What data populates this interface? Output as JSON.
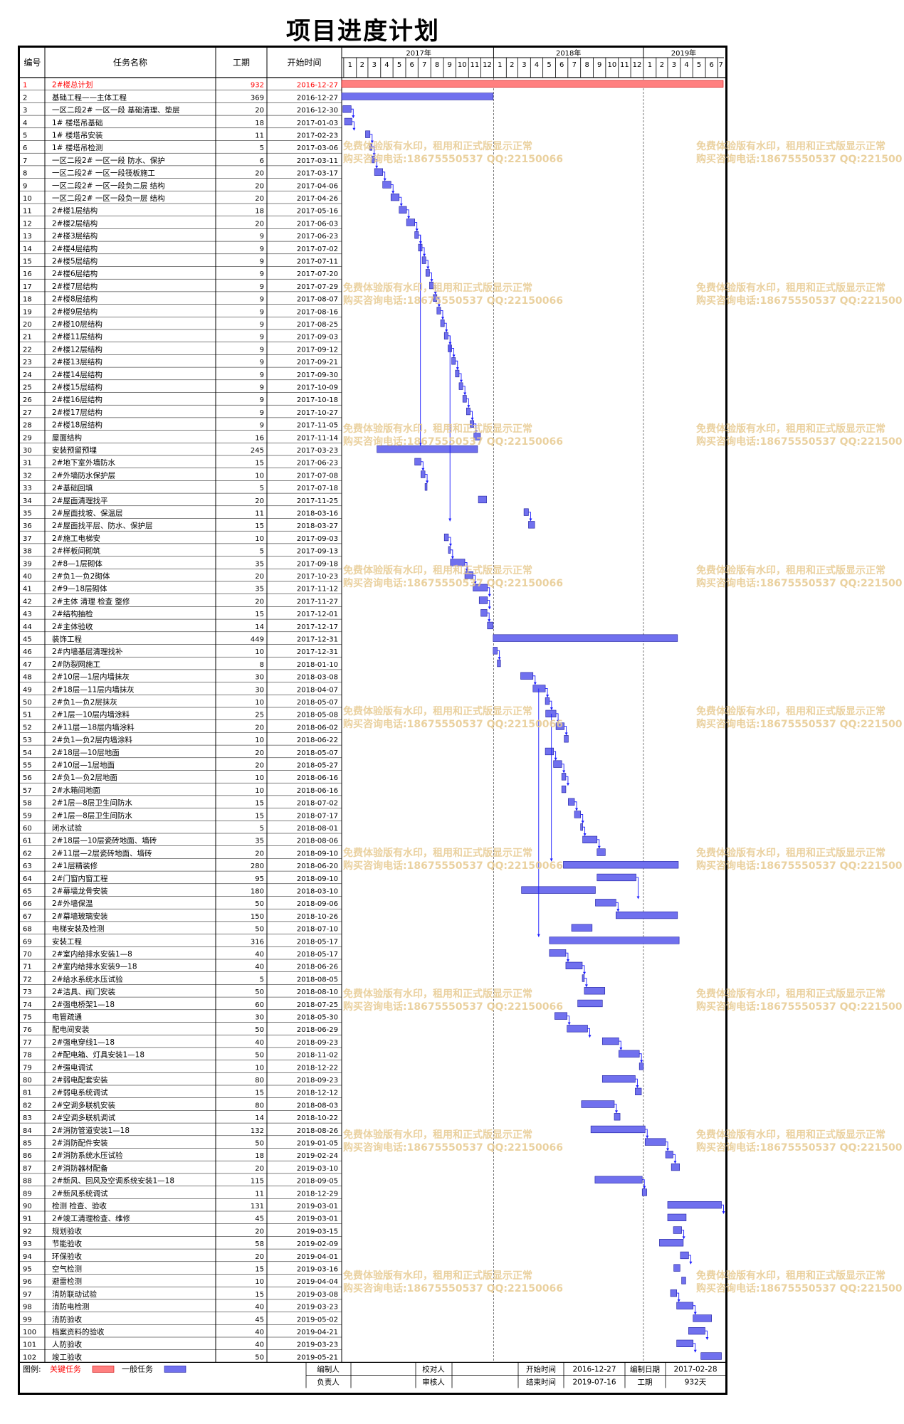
{
  "title": "项目进度计划",
  "columns": {
    "id": "编号",
    "name": "任务名称",
    "duration": "工期",
    "start": "开始时间"
  },
  "timeline": {
    "years": [
      {
        "label": "2017年",
        "months": [
          "1",
          "2",
          "3",
          "4",
          "5",
          "6",
          "7",
          "8",
          "9",
          "10",
          "11",
          "12"
        ]
      },
      {
        "label": "2018年",
        "months": [
          "1",
          "2",
          "3",
          "4",
          "5",
          "6",
          "7",
          "8",
          "9",
          "10",
          "11",
          "12"
        ]
      },
      {
        "label": "2019年",
        "months": [
          "1",
          "2",
          "3",
          "4",
          "5",
          "6",
          "7"
        ]
      }
    ]
  },
  "colors": {
    "critical": "#ff7f7f",
    "normal": "#7070ee",
    "critical_text": "#ff0000",
    "link": "#1c1cff"
  },
  "chart_data": {
    "type": "gantt",
    "timeline_start": "2016-12-27",
    "tasks": [
      {
        "id": "1",
        "name": "2#楼总计划",
        "duration": "932",
        "start": "2016-12-27",
        "critical": true
      },
      {
        "id": "2",
        "name": "基础工程——主体工程",
        "duration": "369",
        "start": "2016-12-27"
      },
      {
        "id": "3",
        "name": "一区二段2# 一区一段 基础清理、垫层",
        "duration": "20",
        "start": "2016-12-30"
      },
      {
        "id": "4",
        "name": "1# 楼塔吊基础",
        "duration": "18",
        "start": "2017-01-03"
      },
      {
        "id": "5",
        "name": "1# 楼塔吊安装",
        "duration": "11",
        "start": "2017-02-23"
      },
      {
        "id": "6",
        "name": "1# 楼塔吊检测",
        "duration": "5",
        "start": "2017-03-06"
      },
      {
        "id": "7",
        "name": "一区二段2# 一区一段 防水、保护",
        "duration": "6",
        "start": "2017-03-11"
      },
      {
        "id": "8",
        "name": "一区二段2# 一区一段筏板施工",
        "duration": "20",
        "start": "2017-03-17"
      },
      {
        "id": "9",
        "name": "一区二段2# 一区一段负二层 结构",
        "duration": "20",
        "start": "2017-04-06"
      },
      {
        "id": "10",
        "name": "一区二段2# 一区一段负一层 结构",
        "duration": "20",
        "start": "2017-04-26"
      },
      {
        "id": "11",
        "name": "2#楼1层结构",
        "duration": "18",
        "start": "2017-05-16"
      },
      {
        "id": "12",
        "name": "2#楼2层结构",
        "duration": "20",
        "start": "2017-06-03"
      },
      {
        "id": "13",
        "name": "2#楼3层结构",
        "duration": "9",
        "start": "2017-06-23"
      },
      {
        "id": "14",
        "name": "2#楼4层结构",
        "duration": "9",
        "start": "2017-07-02"
      },
      {
        "id": "15",
        "name": "2#楼5层结构",
        "duration": "9",
        "start": "2017-07-11"
      },
      {
        "id": "16",
        "name": "2#楼6层结构",
        "duration": "9",
        "start": "2017-07-20"
      },
      {
        "id": "17",
        "name": "2#楼7层结构",
        "duration": "9",
        "start": "2017-07-29"
      },
      {
        "id": "18",
        "name": "2#楼8层结构",
        "duration": "9",
        "start": "2017-08-07"
      },
      {
        "id": "19",
        "name": "2#楼9层结构",
        "duration": "9",
        "start": "2017-08-16"
      },
      {
        "id": "20",
        "name": "2#楼10层结构",
        "duration": "9",
        "start": "2017-08-25"
      },
      {
        "id": "21",
        "name": "2#楼11层结构",
        "duration": "9",
        "start": "2017-09-03"
      },
      {
        "id": "22",
        "name": "2#楼12层结构",
        "duration": "9",
        "start": "2017-09-12"
      },
      {
        "id": "23",
        "name": "2#楼13层结构",
        "duration": "9",
        "start": "2017-09-21"
      },
      {
        "id": "24",
        "name": "2#楼14层结构",
        "duration": "9",
        "start": "2017-09-30"
      },
      {
        "id": "25",
        "name": "2#楼15层结构",
        "duration": "9",
        "start": "2017-10-09"
      },
      {
        "id": "26",
        "name": "2#楼16层结构",
        "duration": "9",
        "start": "2017-10-18"
      },
      {
        "id": "27",
        "name": "2#楼17层结构",
        "duration": "9",
        "start": "2017-10-27"
      },
      {
        "id": "28",
        "name": "2#楼18层结构",
        "duration": "9",
        "start": "2017-11-05"
      },
      {
        "id": "29",
        "name": "屋面结构",
        "duration": "16",
        "start": "2017-11-14"
      },
      {
        "id": "30",
        "name": "安装预留预埋",
        "duration": "245",
        "start": "2017-03-23"
      },
      {
        "id": "31",
        "name": "2#地下室外墙防水",
        "duration": "15",
        "start": "2017-06-23"
      },
      {
        "id": "32",
        "name": "2#外墙防水保护层",
        "duration": "10",
        "start": "2017-07-08"
      },
      {
        "id": "33",
        "name": "2#基础回填",
        "duration": "5",
        "start": "2017-07-18"
      },
      {
        "id": "34",
        "name": "2#屋面清理找平",
        "duration": "20",
        "start": "2017-11-25"
      },
      {
        "id": "35",
        "name": "2#屋面找坡、保温层",
        "duration": "11",
        "start": "2018-03-16"
      },
      {
        "id": "36",
        "name": "2#屋面找平层、防水、保护层",
        "duration": "15",
        "start": "2018-03-27"
      },
      {
        "id": "37",
        "name": "2#施工电梯安",
        "duration": "10",
        "start": "2017-09-03"
      },
      {
        "id": "38",
        "name": "2#样板间砌筑",
        "duration": "5",
        "start": "2017-09-13"
      },
      {
        "id": "39",
        "name": "2#8—1层砌体",
        "duration": "35",
        "start": "2017-09-18"
      },
      {
        "id": "40",
        "name": "2#负1—负2砌体",
        "duration": "20",
        "start": "2017-10-23"
      },
      {
        "id": "41",
        "name": "2#9—18层砌体",
        "duration": "35",
        "start": "2017-11-12"
      },
      {
        "id": "42",
        "name": "2#主体 清理 检查 整修",
        "duration": "20",
        "start": "2017-11-27"
      },
      {
        "id": "43",
        "name": "2#结构抽检",
        "duration": "15",
        "start": "2017-12-01"
      },
      {
        "id": "44",
        "name": "2#主体验收",
        "duration": "14",
        "start": "2017-12-17"
      },
      {
        "id": "45",
        "name": "装饰工程",
        "duration": "449",
        "start": "2017-12-31"
      },
      {
        "id": "46",
        "name": "2#内墙基层清理找补",
        "duration": "10",
        "start": "2017-12-31"
      },
      {
        "id": "47",
        "name": "2#防裂网施工",
        "duration": "8",
        "start": "2018-01-10"
      },
      {
        "id": "48",
        "name": "2#10层—1层内墙抹灰",
        "duration": "30",
        "start": "2018-03-08"
      },
      {
        "id": "49",
        "name": "2#18层—11层内墙抹灰",
        "duration": "30",
        "start": "2018-04-07"
      },
      {
        "id": "50",
        "name": "2#负1—负2层抹灰",
        "duration": "10",
        "start": "2018-05-07"
      },
      {
        "id": "51",
        "name": "2#1层—10层内墙涂料",
        "duration": "25",
        "start": "2018-05-08"
      },
      {
        "id": "52",
        "name": "2#11层—18层内墙涂料",
        "duration": "20",
        "start": "2018-06-02"
      },
      {
        "id": "53",
        "name": "2#负1—负2层内墙涂料",
        "duration": "10",
        "start": "2018-06-22"
      },
      {
        "id": "54",
        "name": "2#18层—10层地面",
        "duration": "20",
        "start": "2018-05-07"
      },
      {
        "id": "55",
        "name": "2#10层—1层地面",
        "duration": "20",
        "start": "2018-05-27"
      },
      {
        "id": "56",
        "name": "2#负1—负2层地面",
        "duration": "10",
        "start": "2018-06-16"
      },
      {
        "id": "57",
        "name": "2#水箱间地面",
        "duration": "10",
        "start": "2018-06-16"
      },
      {
        "id": "58",
        "name": "2#1层—8层卫生间防水",
        "duration": "15",
        "start": "2018-07-02"
      },
      {
        "id": "59",
        "name": "2#1层—8层卫生间防水",
        "duration": "15",
        "start": "2018-07-17"
      },
      {
        "id": "60",
        "name": "闭水试验",
        "duration": "5",
        "start": "2018-08-01"
      },
      {
        "id": "61",
        "name": "2#18层—10层瓷砖地面、墙砖",
        "duration": "35",
        "start": "2018-08-06"
      },
      {
        "id": "62",
        "name": "2#11层—2层瓷砖地面、墙砖",
        "duration": "20",
        "start": "2018-09-10"
      },
      {
        "id": "63",
        "name": "2#1层精装修",
        "duration": "280",
        "start": "2018-06-20"
      },
      {
        "id": "64",
        "name": "2#门窗内窗工程",
        "duration": "95",
        "start": "2018-09-10"
      },
      {
        "id": "65",
        "name": "2#幕墙龙骨安装",
        "duration": "180",
        "start": "2018-03-10"
      },
      {
        "id": "66",
        "name": "2#外墙保温",
        "duration": "50",
        "start": "2018-09-06"
      },
      {
        "id": "67",
        "name": "2#幕墙玻璃安装",
        "duration": "150",
        "start": "2018-10-26"
      },
      {
        "id": "68",
        "name": "电梯安装及检测",
        "duration": "50",
        "start": "2018-07-10"
      },
      {
        "id": "69",
        "name": "安装工程",
        "duration": "316",
        "start": "2018-05-17"
      },
      {
        "id": "70",
        "name": "2#室内给排水安装1—8",
        "duration": "40",
        "start": "2018-05-17"
      },
      {
        "id": "71",
        "name": "2#室内给排水安装9—18",
        "duration": "40",
        "start": "2018-06-26"
      },
      {
        "id": "72",
        "name": "2#给水系统水压试验",
        "duration": "5",
        "start": "2018-08-05"
      },
      {
        "id": "73",
        "name": "2#洁具、阀门安装",
        "duration": "50",
        "start": "2018-08-10"
      },
      {
        "id": "74",
        "name": "2#强电桥架1—18",
        "duration": "60",
        "start": "2018-07-25"
      },
      {
        "id": "75",
        "name": "电管疏通",
        "duration": "30",
        "start": "2018-05-30"
      },
      {
        "id": "76",
        "name": "配电间安装",
        "duration": "50",
        "start": "2018-06-29"
      },
      {
        "id": "77",
        "name": "2#强电穿线1—18",
        "duration": "40",
        "start": "2018-09-23"
      },
      {
        "id": "78",
        "name": "2#配电箱、灯具安装1—18",
        "duration": "50",
        "start": "2018-11-02"
      },
      {
        "id": "79",
        "name": "2#强电调试",
        "duration": "10",
        "start": "2018-12-22"
      },
      {
        "id": "80",
        "name": "2#弱电配套安装",
        "duration": "80",
        "start": "2018-09-23"
      },
      {
        "id": "81",
        "name": "2#弱电系统调试",
        "duration": "15",
        "start": "2018-12-12"
      },
      {
        "id": "82",
        "name": "2#空调多联机安装",
        "duration": "80",
        "start": "2018-08-03"
      },
      {
        "id": "83",
        "name": "2#空调多联机调试",
        "duration": "14",
        "start": "2018-10-22"
      },
      {
        "id": "84",
        "name": "2#消防管道安装1—18",
        "duration": "132",
        "start": "2018-08-26"
      },
      {
        "id": "85",
        "name": "2#消防配件安装",
        "duration": "50",
        "start": "2019-01-05"
      },
      {
        "id": "86",
        "name": "2#消防系统水压试验",
        "duration": "18",
        "start": "2019-02-24"
      },
      {
        "id": "87",
        "name": "2#消防器材配备",
        "duration": "20",
        "start": "2019-03-10"
      },
      {
        "id": "88",
        "name": "2#新风、回风及空调系统安装1—18",
        "duration": "115",
        "start": "2018-09-05"
      },
      {
        "id": "89",
        "name": "2#新风系统调试",
        "duration": "11",
        "start": "2018-12-29"
      },
      {
        "id": "90",
        "name": "检测 检查、验收",
        "duration": "131",
        "start": "2019-03-01"
      },
      {
        "id": "91",
        "name": "2#竣工清理检查、维修",
        "duration": "45",
        "start": "2019-03-01"
      },
      {
        "id": "92",
        "name": "规划验收",
        "duration": "20",
        "start": "2019-03-15"
      },
      {
        "id": "93",
        "name": "节能验收",
        "duration": "58",
        "start": "2019-02-09"
      },
      {
        "id": "94",
        "name": "环保验收",
        "duration": "20",
        "start": "2019-04-01"
      },
      {
        "id": "95",
        "name": "空气检测",
        "duration": "15",
        "start": "2019-03-16"
      },
      {
        "id": "96",
        "name": "避雷检测",
        "duration": "10",
        "start": "2019-04-04"
      },
      {
        "id": "97",
        "name": "消防联动试验",
        "duration": "15",
        "start": "2019-03-08"
      },
      {
        "id": "98",
        "name": "消防电检测",
        "duration": "40",
        "start": "2019-03-23"
      },
      {
        "id": "99",
        "name": "消防验收",
        "duration": "45",
        "start": "2019-05-02"
      },
      {
        "id": "100",
        "name": "档案资料的验收",
        "duration": "40",
        "start": "2019-04-21"
      },
      {
        "id": "101",
        "name": "人防验收",
        "duration": "40",
        "start": "2019-03-23"
      },
      {
        "id": "102",
        "name": "竣工验收",
        "duration": "50",
        "start": "2019-05-21"
      }
    ]
  },
  "watermark": {
    "line1": "免费体验版有水印，租用和正式版显示正常",
    "line2": "购买咨询电话:18675550537 QQ:22150066"
  },
  "footer": {
    "legend_label": "图例:",
    "critical_label": "关键任务",
    "normal_label": "一般任务",
    "editor_label": "编制人",
    "owner_label": "负责人",
    "checker_label": "校对人",
    "reviewer_label": "审核人",
    "start_label": "开始时间",
    "start_value": "2016-12-27",
    "end_label": "结束时间",
    "end_value": "2019-07-16",
    "date_label": "编制日期",
    "date_value": "2017-02-28",
    "duration_label": "工期",
    "duration_value": "932天"
  }
}
